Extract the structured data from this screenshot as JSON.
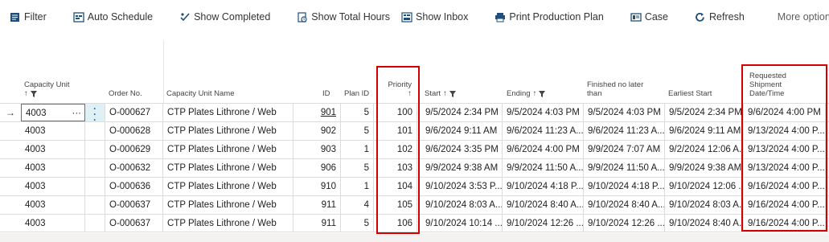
{
  "toolbar": {
    "filter": "Filter",
    "auto_schedule": "Auto Schedule",
    "show_completed": "Show Completed",
    "show_total_hours": "Show Total Hours",
    "show_inbox": "Show Inbox",
    "print_production_plan": "Print Production Plan",
    "case": "Case",
    "refresh": "Refresh",
    "more_options": "More options"
  },
  "columns": {
    "capacity_unit": "Capacity Unit",
    "order_no": "Order No.",
    "capacity_unit_name": "Capacity Unit Name",
    "id": "ID",
    "plan_id": "Plan ID",
    "priority": "Priority",
    "start": "Start",
    "ending": "Ending",
    "finished_no_later_line1": "Finished no later",
    "finished_no_later_line2": "than",
    "earliest_start": "Earliest Start",
    "requested_line1": "Requested",
    "requested_line2": "Shipment",
    "requested_line3": "Date/Time"
  },
  "rows": [
    {
      "capacity_unit": "4003",
      "order_no": "O-000627",
      "name": "CTP Plates Lithrone / Web",
      "id": "901",
      "plan_id": "5",
      "priority": "100",
      "start": "9/5/2024 2:34 PM",
      "ending": "9/5/2024 4:03 PM",
      "finished": "9/5/2024 4:03 PM",
      "earliest": "9/5/2024 2:34 PM",
      "requested": "9/6/2024 4:00 PM"
    },
    {
      "capacity_unit": "4003",
      "order_no": "O-000628",
      "name": "CTP Plates Lithrone / Web",
      "id": "902",
      "plan_id": "5",
      "priority": "101",
      "start": "9/6/2024 9:11 AM",
      "ending": "9/6/2024 11:23 A...",
      "finished": "9/6/2024 11:23 A...",
      "earliest": "9/6/2024 9:11 AM",
      "requested": "9/13/2024 4:00 P..."
    },
    {
      "capacity_unit": "4003",
      "order_no": "O-000629",
      "name": "CTP Plates Lithrone / Web",
      "id": "903",
      "plan_id": "1",
      "priority": "102",
      "start": "9/6/2024 3:35 PM",
      "ending": "9/6/2024 4:00 PM",
      "finished": "9/9/2024 7:07 AM",
      "earliest": "9/2/2024 12:06 A...",
      "requested": "9/13/2024 4:00 P..."
    },
    {
      "capacity_unit": "4003",
      "order_no": "O-000632",
      "name": "CTP Plates Lithrone / Web",
      "id": "906",
      "plan_id": "5",
      "priority": "103",
      "start": "9/9/2024 9:38 AM",
      "ending": "9/9/2024 11:50 A...",
      "finished": "9/9/2024 11:50 A...",
      "earliest": "9/9/2024 9:38 AM",
      "requested": "9/13/2024 4:00 P..."
    },
    {
      "capacity_unit": "4003",
      "order_no": "O-000636",
      "name": "CTP Plates Lithrone / Web",
      "id": "910",
      "plan_id": "1",
      "priority": "104",
      "start": "9/10/2024 3:53 P...",
      "ending": "9/10/2024 4:18 P...",
      "finished": "9/10/2024 4:18 P...",
      "earliest": "9/10/2024 12:06 ...",
      "requested": "9/16/2024 4:00 P..."
    },
    {
      "capacity_unit": "4003",
      "order_no": "O-000637",
      "name": "CTP Plates Lithrone / Web",
      "id": "911",
      "plan_id": "4",
      "priority": "105",
      "start": "9/10/2024 8:03 A...",
      "ending": "9/10/2024 8:40 A...",
      "finished": "9/10/2024 8:40 A...",
      "earliest": "9/10/2024 8:03 A...",
      "requested": "9/16/2024 4:00 P..."
    },
    {
      "capacity_unit": "4003",
      "order_no": "O-000637",
      "name": "CTP Plates Lithrone / Web",
      "id": "911",
      "plan_id": "5",
      "priority": "106",
      "start": "9/10/2024 10:14 ...",
      "ending": "9/10/2024 12:26 ...",
      "finished": "9/10/2024 12:26 ...",
      "earliest": "9/10/2024 8:40 A...",
      "requested": "9/16/2024 4:00 P..."
    }
  ],
  "colors": {
    "accent_blue": "#0a6ebd",
    "highlight_red": "#d40000",
    "selected_menu_bg": "#dff1f5"
  },
  "icons": [
    "filter-icon",
    "auto-schedule-icon",
    "show-completed-icon",
    "total-hours-icon",
    "inbox-icon",
    "print-icon",
    "case-icon",
    "refresh-icon",
    "chevron-down-icon",
    "sort-up-icon",
    "funnel-icon",
    "row-arrow-icon",
    "more-dots-icon"
  ]
}
